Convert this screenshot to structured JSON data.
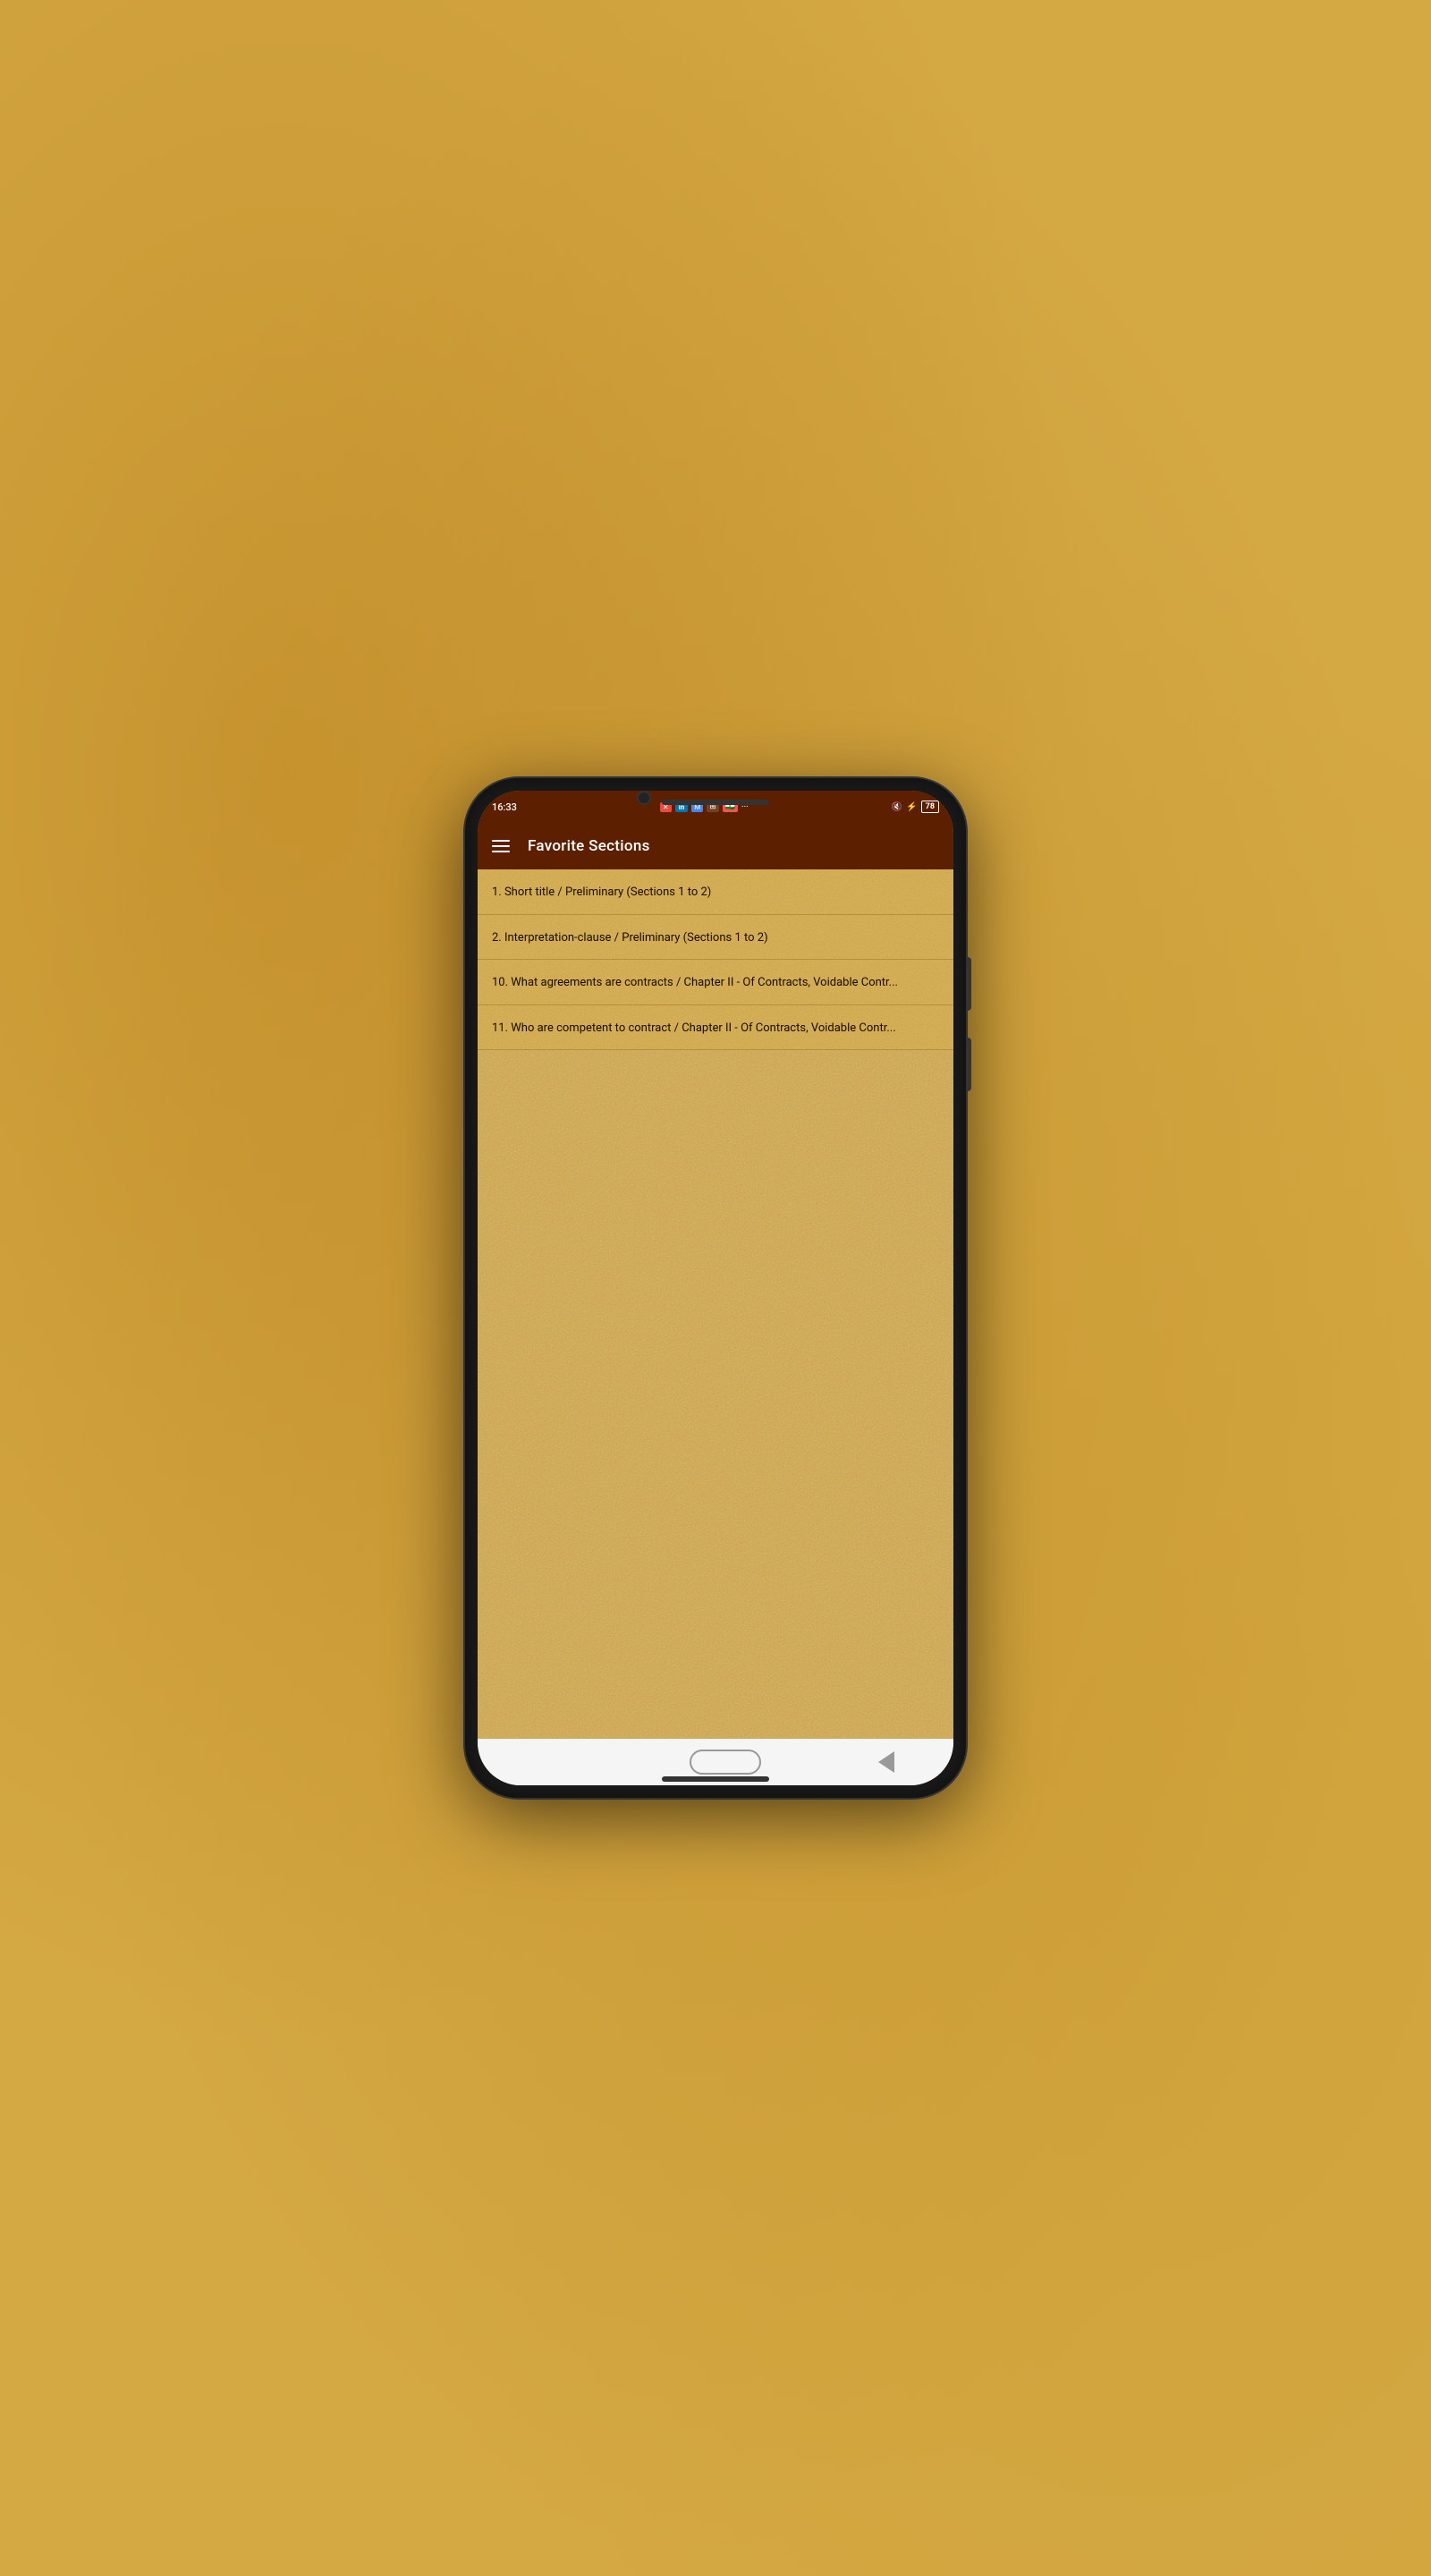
{
  "device": {
    "speaker_top": true,
    "speaker_bottom": true
  },
  "status_bar": {
    "time": "16:33",
    "notification_icons": [
      "X",
      "in",
      "M",
      "grid",
      "flag",
      "..."
    ],
    "battery": "78",
    "bluetooth": true,
    "silent": true
  },
  "app_bar": {
    "title": "Favorite Sections",
    "menu_icon": "hamburger"
  },
  "list_items": [
    {
      "id": 1,
      "text": "1. Short title / Preliminary (Sections 1 to 2)"
    },
    {
      "id": 2,
      "text": "2. Interpretation-clause / Preliminary (Sections 1 to 2)"
    },
    {
      "id": 3,
      "text": "10. What agreements are contracts / Chapter II - Of Contracts, Voidable Contr..."
    },
    {
      "id": 4,
      "text": "11. Who are competent to contract / Chapter II - Of Contracts, Voidable Contr..."
    }
  ],
  "bottom_bar": {
    "home_label": "Home",
    "back_label": "Back"
  }
}
